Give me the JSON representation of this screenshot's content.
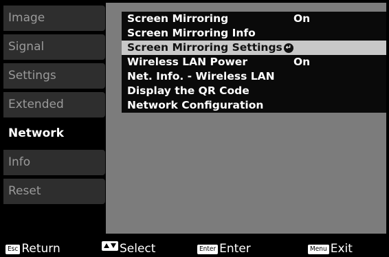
{
  "sidebar": {
    "items": [
      {
        "label": "Image"
      },
      {
        "label": "Signal"
      },
      {
        "label": "Settings"
      },
      {
        "label": "Extended"
      },
      {
        "label": "Network"
      },
      {
        "label": "Info"
      },
      {
        "label": "Reset"
      }
    ],
    "active": "Network"
  },
  "menu": {
    "rows": [
      {
        "label": "Screen Mirroring",
        "value": "On"
      },
      {
        "label": "Screen Mirroring Info",
        "value": ""
      },
      {
        "label": "Screen Mirroring Settings",
        "value": ""
      },
      {
        "label": "Wireless LAN Power",
        "value": "On"
      },
      {
        "label": "Net. Info. - Wireless LAN",
        "value": ""
      },
      {
        "label": "Display the QR Code",
        "value": ""
      },
      {
        "label": "Network Configuration",
        "value": ""
      }
    ],
    "selected_index": 2
  },
  "bottom_bar": {
    "return": {
      "key": "Esc",
      "label": "Return"
    },
    "select": {
      "label": "Select"
    },
    "enter": {
      "key": "Enter",
      "label": "Enter"
    },
    "exit": {
      "key": "Menu",
      "label": "Exit"
    }
  },
  "colors": {
    "panel_bg": "#7c7c7c",
    "row_bg": "#0a0a0a",
    "selected_bg": "#c8c8c8",
    "sidebar_inactive_bg": "#2e2e2e"
  }
}
